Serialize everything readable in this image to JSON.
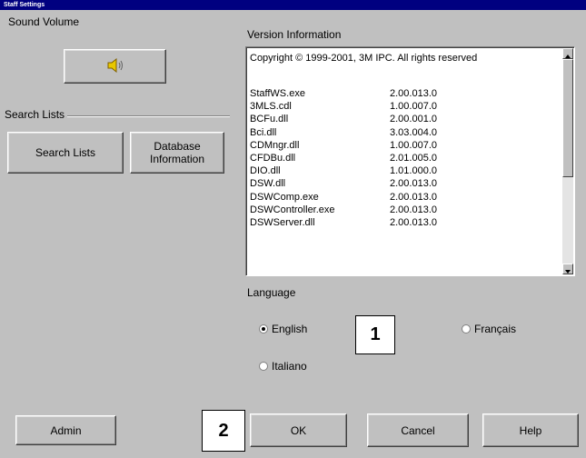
{
  "window": {
    "title": "Staff Settings"
  },
  "sound": {
    "label": "Sound Volume",
    "icon": "speaker-icon"
  },
  "search": {
    "label": "Search Lists",
    "search_lists_button": "Search Lists",
    "database_info_button": "Database Information"
  },
  "version": {
    "label": "Version Information",
    "copyright": "Copyright © 1999-2001, 3M IPC.  All rights reserved",
    "files": [
      {
        "name": "StaffWS.exe",
        "version": "2.00.013.0"
      },
      {
        "name": "3MLS.cdl",
        "version": "1.00.007.0"
      },
      {
        "name": "BCFu.dll",
        "version": "2.00.001.0"
      },
      {
        "name": "Bci.dll",
        "version": "3.03.004.0"
      },
      {
        "name": "CDMngr.dll",
        "version": "1.00.007.0"
      },
      {
        "name": "CFDBu.dll",
        "version": "2.01.005.0"
      },
      {
        "name": "DIO.dll",
        "version": "1.01.000.0"
      },
      {
        "name": "DSW.dll",
        "version": "2.00.013.0"
      },
      {
        "name": "DSWComp.exe",
        "version": "2.00.013.0"
      },
      {
        "name": "DSWController.exe",
        "version": "2.00.013.0"
      },
      {
        "name": "DSWServer.dll",
        "version": "2.00.013.0"
      }
    ]
  },
  "language": {
    "label": "Language",
    "options": [
      {
        "label": "English",
        "selected": true
      },
      {
        "label": "Français",
        "selected": false
      },
      {
        "label": "Italiano",
        "selected": false
      }
    ]
  },
  "buttons": {
    "admin": "Admin",
    "ok": "OK",
    "cancel": "Cancel",
    "help": "Help"
  },
  "callouts": {
    "one": "1",
    "two": "2"
  }
}
